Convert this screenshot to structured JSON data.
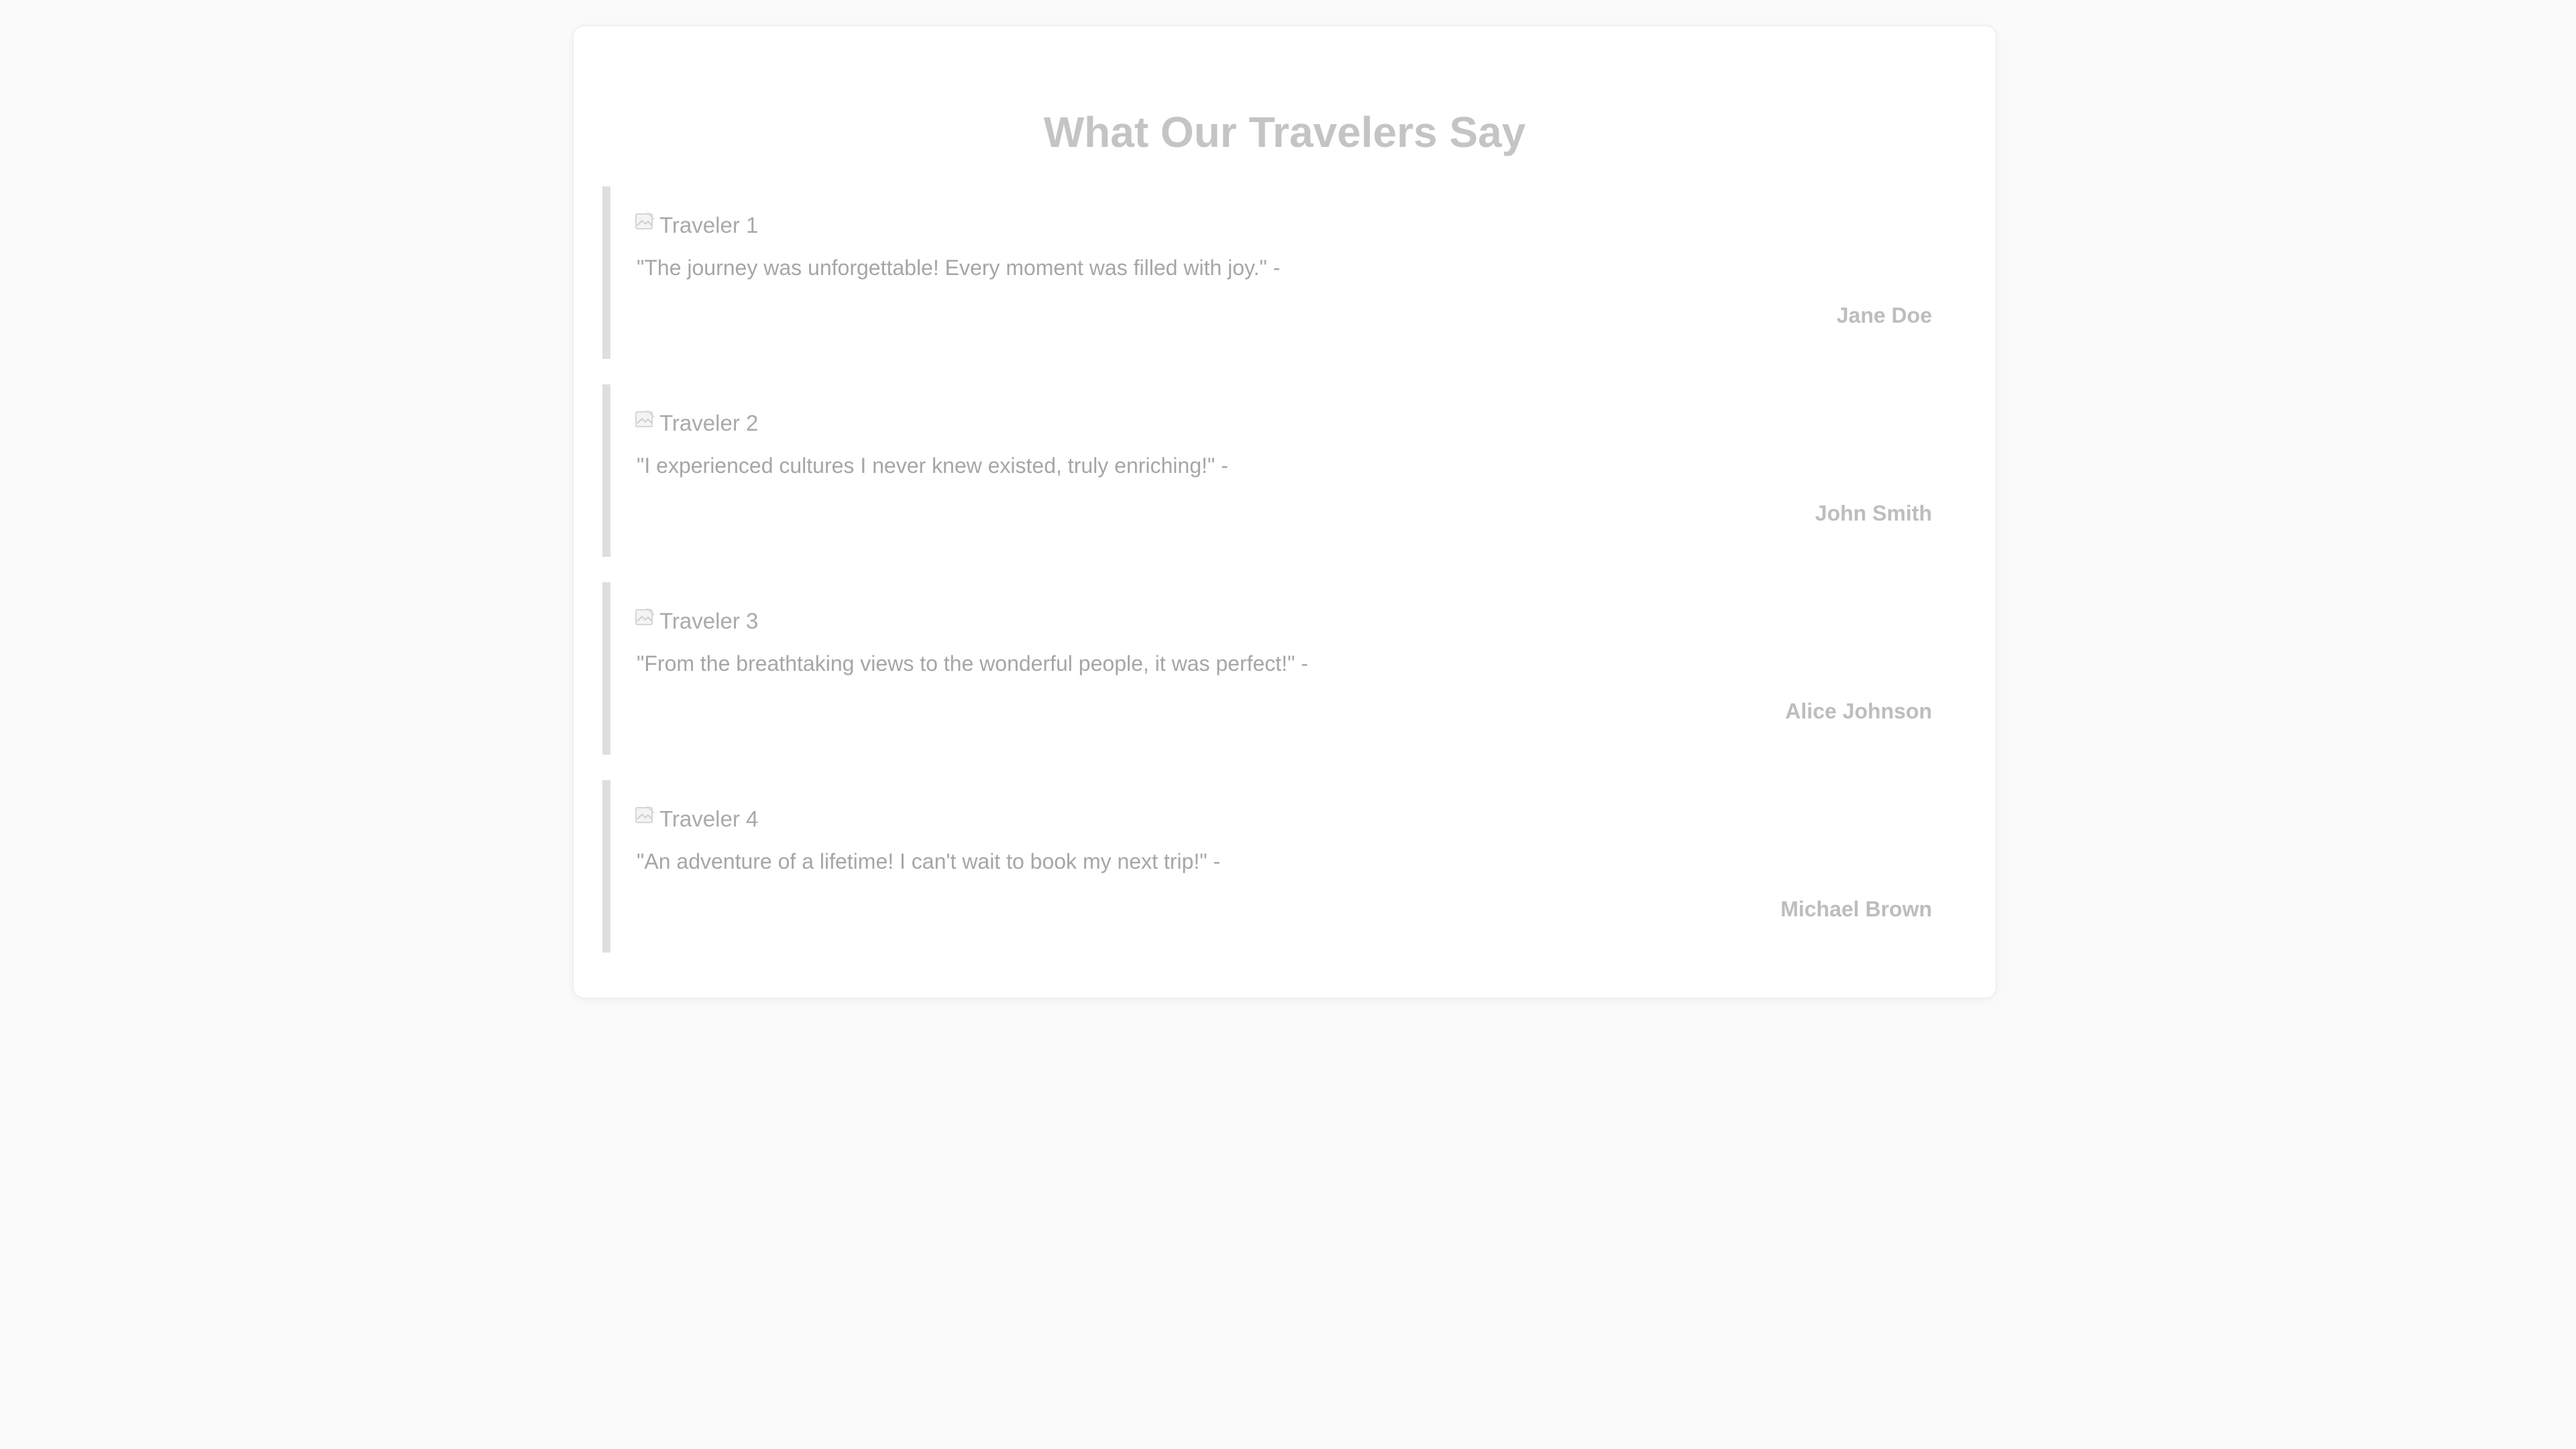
{
  "section": {
    "title": "What Our Travelers Say"
  },
  "testimonials": [
    {
      "image_alt": "Traveler 1",
      "quote": "\"The journey was unforgettable! Every moment was filled with joy.\" -",
      "author": "Jane Doe"
    },
    {
      "image_alt": "Traveler 2",
      "quote": "\"I experienced cultures I never knew existed, truly enriching!\" -",
      "author": "John Smith"
    },
    {
      "image_alt": "Traveler 3",
      "quote": "\"From the breathtaking views to the wonderful people, it was perfect!\" -",
      "author": "Alice Johnson"
    },
    {
      "image_alt": "Traveler 4",
      "quote": "\"An adventure of a lifetime! I can't wait to book my next trip!\" -",
      "author": "Michael Brown"
    }
  ],
  "icons": {
    "broken_image": "broken-image-icon"
  },
  "colors": {
    "background": "#fafafa",
    "card": "#ffffff",
    "accent_border": "#dedede",
    "title": "#c4c4c4",
    "text": "#a6a6a6"
  }
}
